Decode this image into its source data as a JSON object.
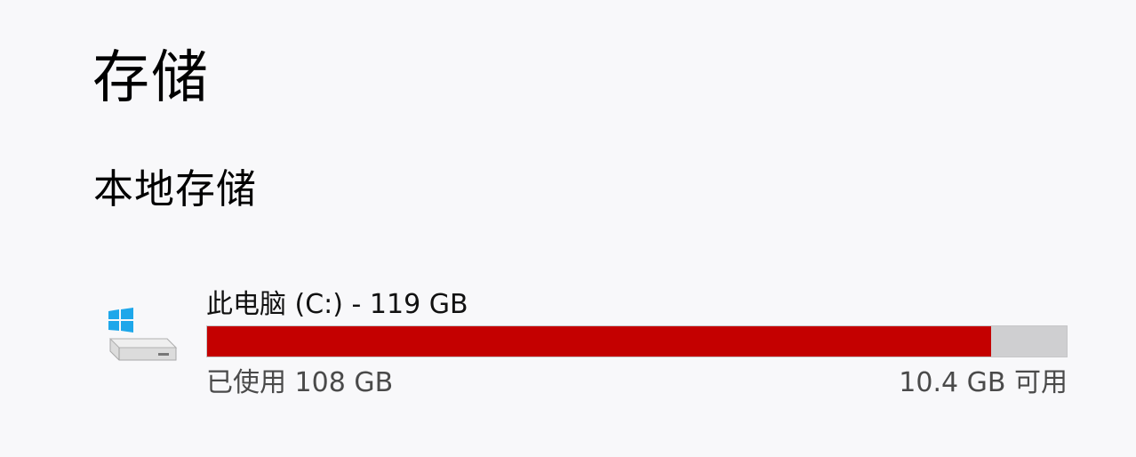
{
  "page": {
    "title": "存储",
    "section_title": "本地存储"
  },
  "drive": {
    "icon": "windows-drive-icon",
    "name": "此电脑 (C:) - 119 GB",
    "used_label": "已使用 108 GB",
    "free_label": "10.4 GB 可用",
    "used_fraction": 0.9125
  },
  "colors": {
    "used_bar": "#c40000",
    "free_bar": "#cfcfd1",
    "windows_logo": "#1ea7ea"
  }
}
